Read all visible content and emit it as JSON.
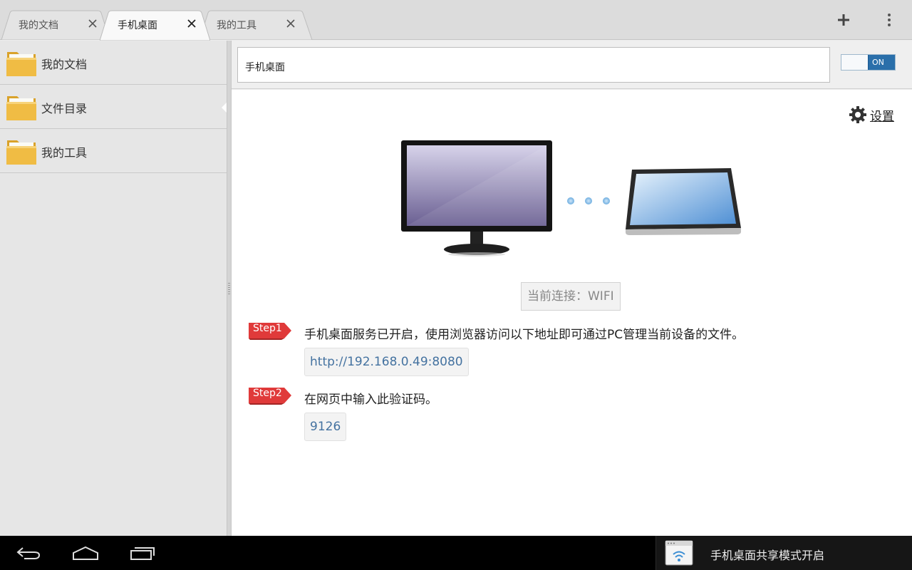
{
  "tabs": [
    {
      "label": "我的文档",
      "active": false
    },
    {
      "label": "手机桌面",
      "active": true
    },
    {
      "label": "我的工具",
      "active": false
    }
  ],
  "toolbar": {
    "add_icon": "plus-icon",
    "menu_icon": "overflow-menu-icon"
  },
  "sidebar": {
    "items": [
      {
        "label": "我的文档",
        "icon": "folder-icon"
      },
      {
        "label": "文件目录",
        "icon": "folder-icon",
        "selected": true
      },
      {
        "label": "我的工具",
        "icon": "folder-icon"
      }
    ]
  },
  "address": {
    "value": "手机桌面"
  },
  "toggle": {
    "state_label": "ON",
    "on": true
  },
  "main": {
    "settings_label": "设置",
    "connection_label": "当前连接：WIFI",
    "steps": [
      {
        "tag": "Step1",
        "text": "手机桌面服务已开启，使用浏览器访问以下地址即可通过PC管理当前设备的文件。",
        "value": "http://192.168.0.49:8080"
      },
      {
        "tag": "Step2",
        "text": "在网页中输入此验证码。",
        "value": "9126"
      }
    ]
  },
  "system_bar": {
    "notification_text": "手机桌面共享模式开启",
    "nav": [
      "back-icon",
      "home-icon",
      "recent-apps-icon"
    ]
  },
  "colors": {
    "accent": "#2a6faa",
    "step_tag": "#e03a3a",
    "link": "#4472a0"
  }
}
